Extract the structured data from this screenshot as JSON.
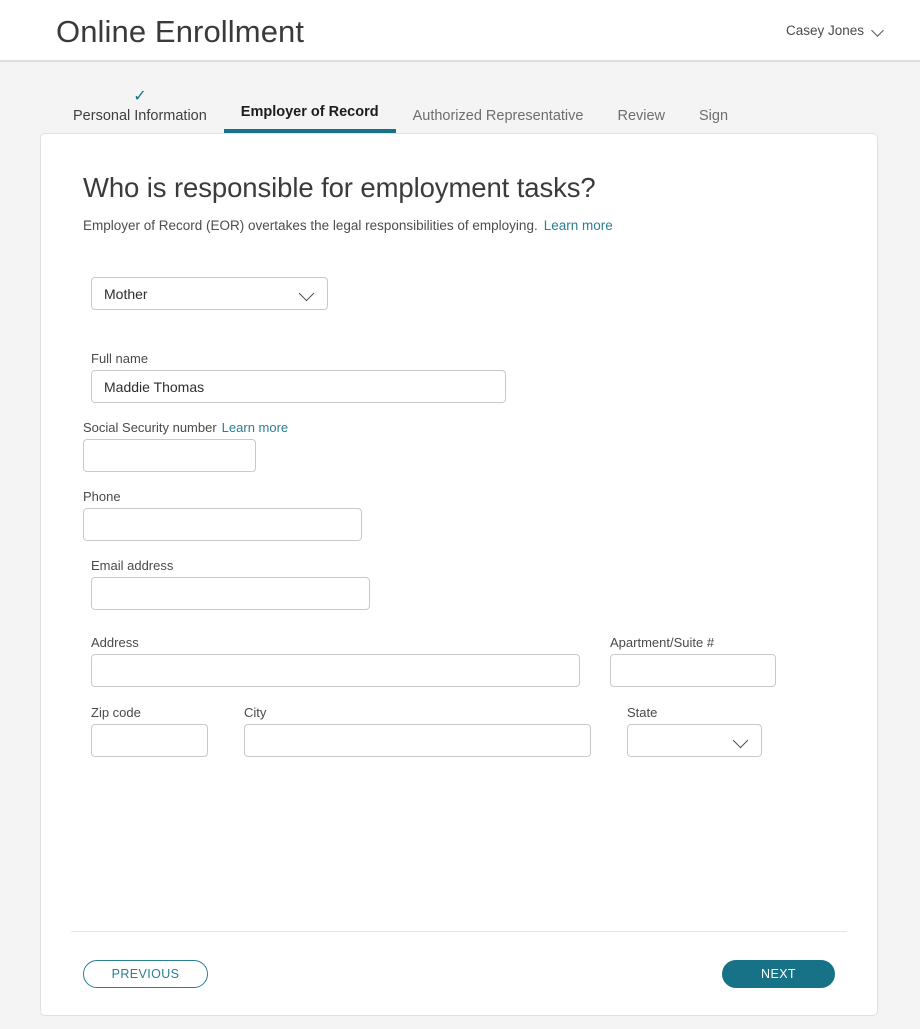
{
  "header": {
    "app_title": "Online Enrollment",
    "user_name": "Casey Jones",
    "user_menu_icon": "chevron-down-icon"
  },
  "stepper": {
    "steps": [
      {
        "label": "Personal Information",
        "state": "completed",
        "check_icon": "✓"
      },
      {
        "label": "Employer of Record",
        "state": "active"
      },
      {
        "label": "Authorized Representative",
        "state": "upcoming"
      },
      {
        "label": "Review",
        "state": "upcoming"
      },
      {
        "label": "Sign",
        "state": "upcoming"
      }
    ]
  },
  "main": {
    "title": "Who is responsible for employment tasks?",
    "subtitle_text": "Employer of Record (EOR) overtakes the legal responsibilities of employing.",
    "subtitle_link": "Learn more"
  },
  "form": {
    "role": {
      "value": "Mother",
      "placeholder": "",
      "dropdown_icon": "chevron-down-icon",
      "options": [
        "Mother"
      ]
    },
    "full_name": {
      "label": "Full name",
      "value": "Maddie Thomas",
      "placeholder": ""
    },
    "ssn": {
      "label": "Social Security number",
      "link": "Learn more",
      "value": "",
      "placeholder": ""
    },
    "phone": {
      "label": "Phone",
      "value": "",
      "placeholder": ""
    },
    "email": {
      "label": "Email address",
      "value": "",
      "placeholder": ""
    },
    "address": {
      "label": "Address",
      "value": "",
      "placeholder": ""
    },
    "apartment": {
      "label": "Apartment/Suite #",
      "value": "",
      "placeholder": ""
    },
    "zip": {
      "label": "Zip code",
      "value": "",
      "placeholder": ""
    },
    "city": {
      "label": "City",
      "value": "",
      "placeholder": ""
    },
    "state": {
      "label": "State",
      "value": "",
      "placeholder": "",
      "dropdown_icon": "chevron-down-icon",
      "options": []
    }
  },
  "footer": {
    "previous_label": "PREVIOUS",
    "next_label": "NEXT"
  },
  "colors": {
    "accent_teal": "#177287",
    "link_teal": "#2a7f93",
    "page_background": "#f5f4f4",
    "card_background": "#ffffff",
    "border_gray": "#c9c9c9"
  }
}
